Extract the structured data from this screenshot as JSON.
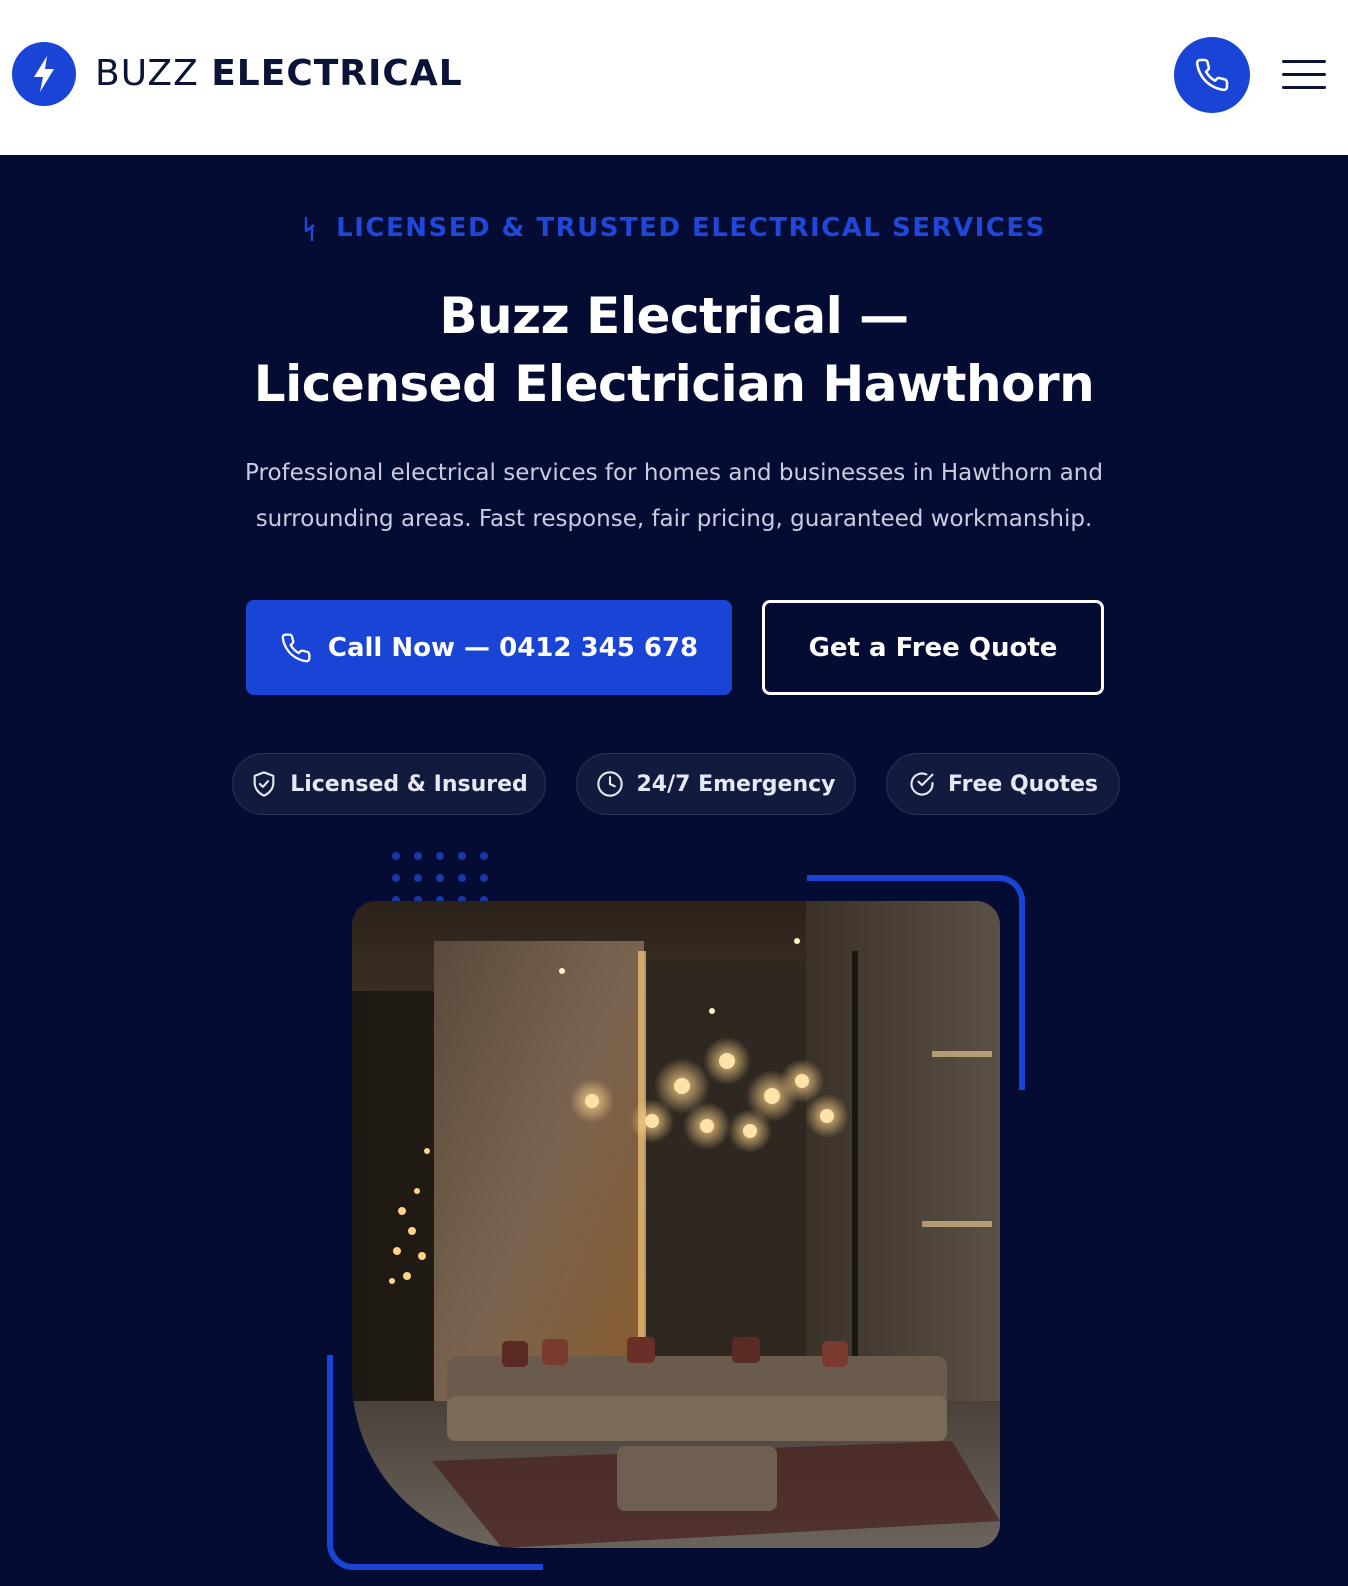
{
  "header": {
    "brand_light": "BUZZ",
    "brand_bold": "ELECTRICAL",
    "logo_icon": "lightning-bolt-icon",
    "call_icon": "phone-icon",
    "menu_icon": "hamburger-menu-icon"
  },
  "hero": {
    "eyebrow": "LICENSED & TRUSTED ELECTRICAL SERVICES",
    "title_line1": "Buzz Electrical —",
    "title_line2": "Licensed Electrician Hawthorn",
    "subtitle": "Professional electrical services for homes and businesses in Hawthorn and surrounding areas. Fast response, fair pricing, guaranteed workmanship.",
    "cta_call": "Call Now — 0412 345 678",
    "cta_quote": "Get a Free Quote",
    "badges": [
      {
        "label": "Licensed & Insured",
        "icon": "shield-check-icon"
      },
      {
        "label": "24/7 Emergency",
        "icon": "clock-icon"
      },
      {
        "label": "Free Quotes",
        "icon": "check-circle-icon"
      }
    ]
  },
  "colors": {
    "accent": "#1a44d6",
    "background": "#050c33",
    "header_bg": "#ffffff",
    "text_dark": "#0b1437"
  }
}
